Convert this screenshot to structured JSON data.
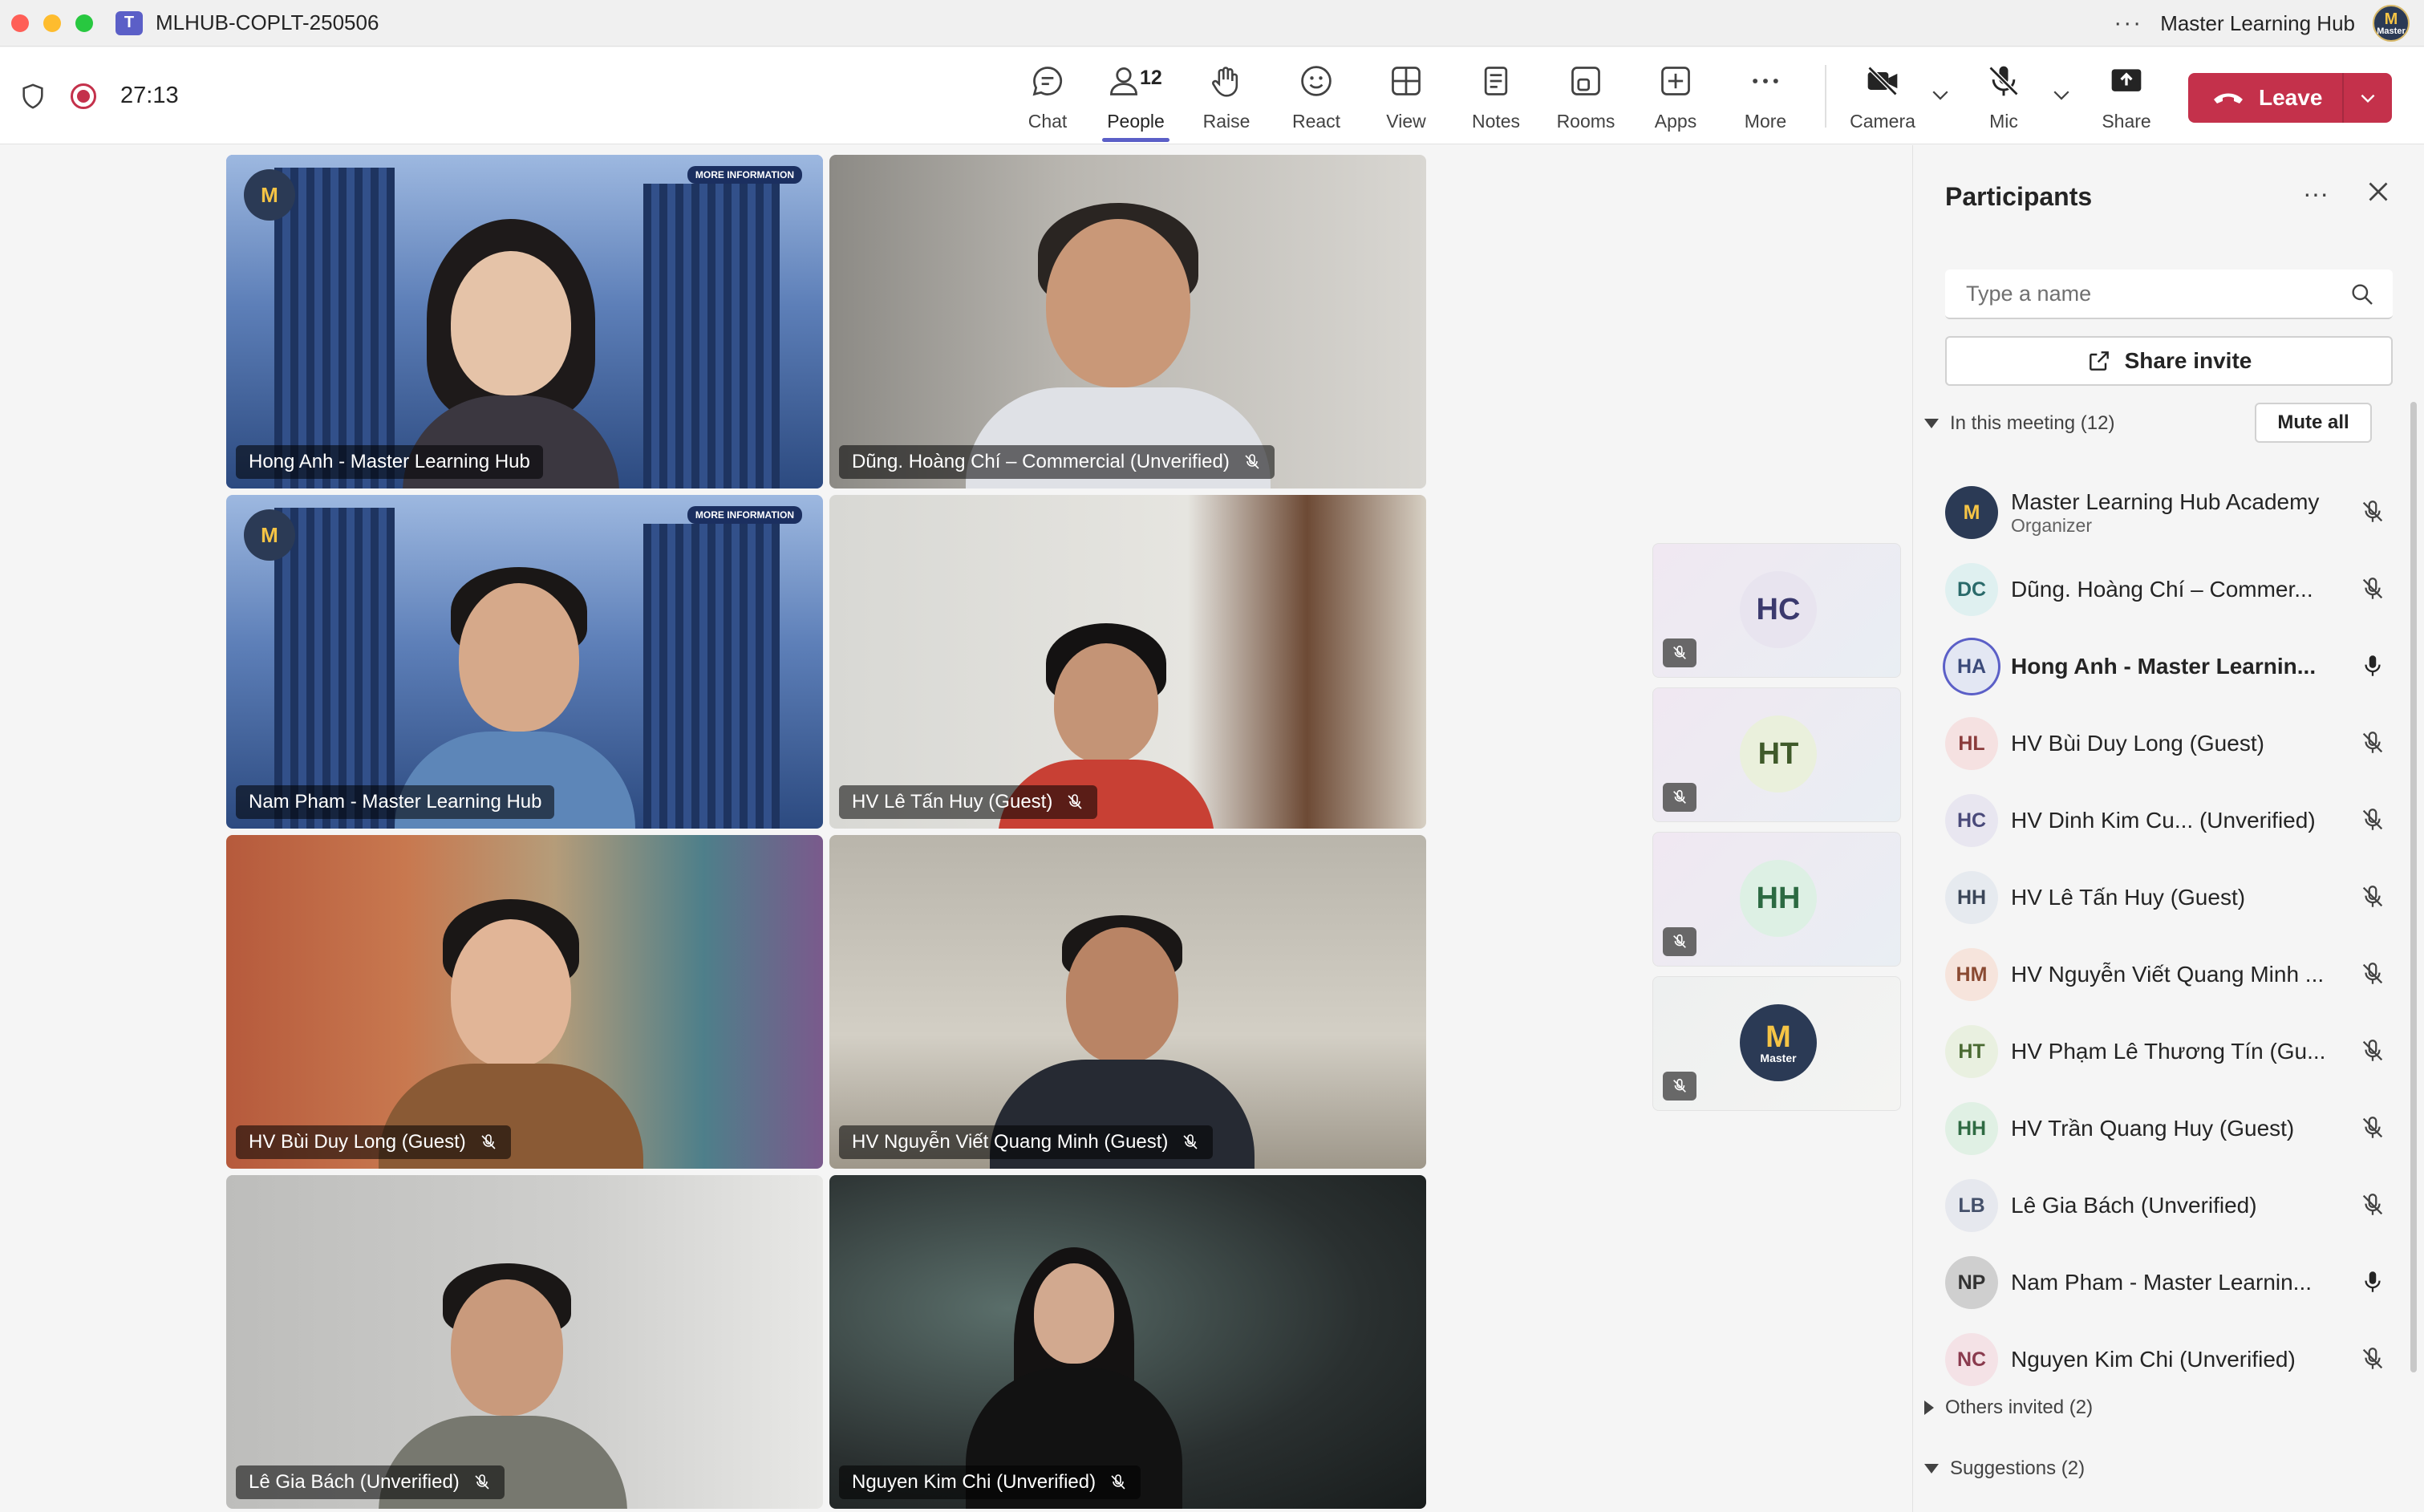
{
  "window": {
    "title": "MLHUB-COPLT-250506",
    "org_name": "Master Learning Hub",
    "org_avatar_text": "Master",
    "org_avatar_glyph": "M"
  },
  "meeting": {
    "timer": "27:13"
  },
  "toolbar": {
    "items": [
      {
        "label": "Chat",
        "icon": "chat-icon"
      },
      {
        "label": "People",
        "icon": "people-icon",
        "count": "12"
      },
      {
        "label": "Raise",
        "icon": "raise-hand-icon"
      },
      {
        "label": "React",
        "icon": "react-icon"
      },
      {
        "label": "View",
        "icon": "view-icon"
      },
      {
        "label": "Notes",
        "icon": "notes-icon"
      },
      {
        "label": "Rooms",
        "icon": "rooms-icon"
      },
      {
        "label": "Apps",
        "icon": "apps-icon"
      },
      {
        "label": "More",
        "icon": "more-icon"
      },
      {
        "label": "Camera",
        "icon": "camera-off-icon"
      },
      {
        "label": "Mic",
        "icon": "mic-off-icon"
      },
      {
        "label": "Share",
        "icon": "share-icon"
      }
    ],
    "leave_label": "Leave"
  },
  "videos": [
    {
      "name": "Hong Anh - Master Learning Hub",
      "muted": false,
      "speaking": true
    },
    {
      "name": "Dũng. Hoàng Chí – Commercial (Unverified)",
      "muted": true
    },
    {
      "name": "Nam Pham - Master Learning Hub",
      "muted": false
    },
    {
      "name": "HV Lê Tấn Huy (Guest)",
      "muted": true
    },
    {
      "name": "HV Bùi Duy Long (Guest)",
      "muted": true
    },
    {
      "name": "HV Nguyễn Viết Quang Minh (Guest)",
      "muted": true
    },
    {
      "name": "Lê Gia Bách (Unverified)",
      "muted": true
    },
    {
      "name": "Nguyen Kim Chi (Unverified)",
      "muted": true
    }
  ],
  "branding": {
    "logo_glyph": "M",
    "logo_text": "Master",
    "more_info": "MORE INFORMATION"
  },
  "avatar_strip": [
    {
      "initials": "HC"
    },
    {
      "initials": "HT"
    },
    {
      "initials": "HH"
    },
    {
      "initials": "M",
      "sub": "Master"
    }
  ],
  "panel": {
    "title": "Participants",
    "search_placeholder": "Type a name",
    "share_invite": "Share invite",
    "in_meeting": "In this meeting (12)",
    "mute_all": "Mute all",
    "others_invited": "Others invited (2)",
    "suggestions": "Suggestions (2)",
    "participants": [
      {
        "initials": "M",
        "name": "Master Learning Hub Academy",
        "role": "Organizer",
        "mic": "off"
      },
      {
        "initials": "DC",
        "name": "Dũng. Hoàng Chí – Commer...",
        "mic": "off"
      },
      {
        "initials": "HA",
        "name": "Hong Anh - Master Learnin...",
        "mic": "on"
      },
      {
        "initials": "HL",
        "name": "HV Bùi Duy Long (Guest)",
        "mic": "off"
      },
      {
        "initials": "HC",
        "name": "HV Dinh Kim Cu...   (Unverified)",
        "mic": "off"
      },
      {
        "initials": "HH",
        "name": "HV Lê Tấn Huy (Guest)",
        "mic": "off"
      },
      {
        "initials": "HM",
        "name": "HV Nguyễn Viết Quang Minh ...",
        "mic": "off"
      },
      {
        "initials": "HT",
        "name": "HV Phạm Lê Thương Tín (Gu...",
        "mic": "off"
      },
      {
        "initials": "HH",
        "name": "HV Trần Quang Huy (Guest)",
        "mic": "off"
      },
      {
        "initials": "LB",
        "name": "Lê Gia Bách (Unverified)",
        "mic": "off"
      },
      {
        "initials": "NP",
        "name": "Nam Pham - Master Learnin...",
        "mic": "on"
      },
      {
        "initials": "NC",
        "name": "Nguyen Kim Chi (Unverified)",
        "mic": "off"
      }
    ]
  },
  "colors": {
    "accent": "#5b5fc7",
    "leave": "#c4314b",
    "speaking_ring": "#7f85f5"
  }
}
